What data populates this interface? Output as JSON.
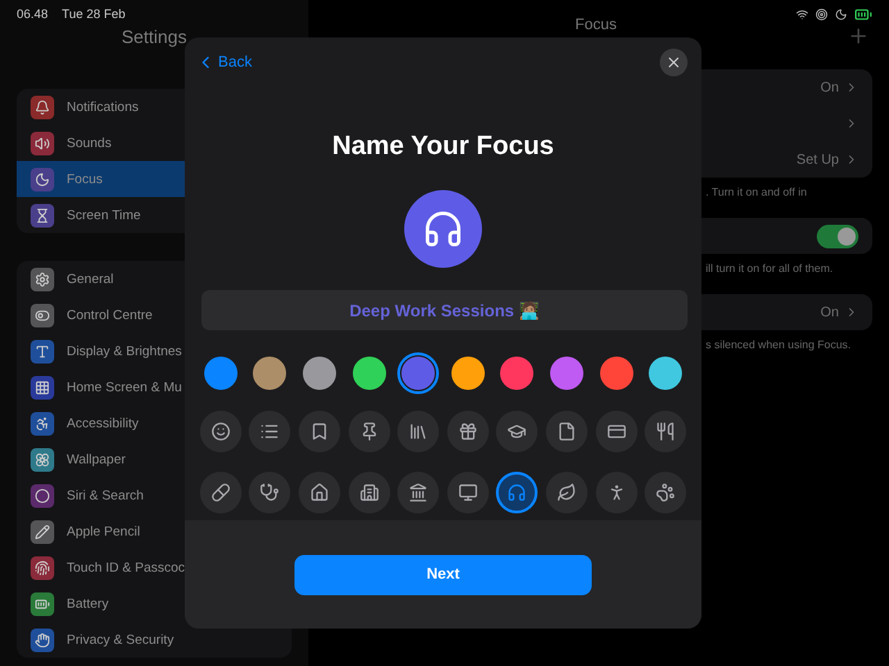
{
  "status_bar": {
    "time": "06.48",
    "date": "Tue 28 Feb"
  },
  "sidebar": {
    "title": "Settings",
    "groups": [
      [
        {
          "label": "Notifications",
          "kind": "bell",
          "color": "#8a2a2a",
          "selected": false
        },
        {
          "label": "Sounds",
          "kind": "speaker",
          "color": "#8a2a3a",
          "selected": false
        },
        {
          "label": "Focus",
          "kind": "moon",
          "color": "#4a3f8a",
          "selected": true
        },
        {
          "label": "Screen Time",
          "kind": "hourglass",
          "color": "#4a3f8a",
          "selected": false
        }
      ],
      [
        {
          "label": "General",
          "kind": "gear",
          "color": "#555558",
          "selected": false
        },
        {
          "label": "Control Centre",
          "kind": "toggles",
          "color": "#555558",
          "selected": false
        },
        {
          "label": "Display & Brightnes",
          "kind": "text",
          "color": "#1f4f9a",
          "selected": false
        },
        {
          "label": "Home Screen & Mu",
          "kind": "grid",
          "color": "#2a3a9a",
          "selected": false
        },
        {
          "label": "Accessibility",
          "kind": "person",
          "color": "#1f4f9a",
          "selected": false
        },
        {
          "label": "Wallpaper",
          "kind": "flower",
          "color": "#2f7a8a",
          "selected": false
        },
        {
          "label": "Siri & Search",
          "kind": "orb",
          "color": "#5a2a6a",
          "selected": false
        },
        {
          "label": "Apple Pencil",
          "kind": "pencil",
          "color": "#555558",
          "selected": false
        },
        {
          "label": "Touch ID & Passcoc",
          "kind": "fingerprint",
          "color": "#8a2a3a",
          "selected": false
        },
        {
          "label": "Battery",
          "kind": "battery",
          "color": "#2a7a3a",
          "selected": false
        },
        {
          "label": "Privacy & Security",
          "kind": "hand",
          "color": "#1f4f9a",
          "selected": false
        }
      ]
    ]
  },
  "detail": {
    "title": "Focus",
    "cards": [
      {
        "rows": [
          {
            "value": "On"
          },
          {
            "value": ""
          },
          {
            "value": "Set Up"
          }
        ],
        "note": ". Turn it on and off in"
      },
      {
        "rows": [
          {
            "toggle": true
          }
        ],
        "note": "ill turn it on for all of them."
      },
      {
        "rows": [
          {
            "value": "On"
          }
        ],
        "note": "s silenced when using Focus."
      }
    ]
  },
  "modal": {
    "back": "Back",
    "title": "Name Your Focus",
    "name_value": "Deep Work Sessions 🧑🏽‍💻",
    "colors": [
      {
        "color": "#0a84ff",
        "selected": false
      },
      {
        "color": "#ac8e68",
        "selected": false
      },
      {
        "color": "#98989d",
        "selected": false
      },
      {
        "color": "#30d158",
        "selected": false
      },
      {
        "color": "#5e5ce6",
        "selected": true
      },
      {
        "color": "#ff9f0a",
        "selected": false
      },
      {
        "color": "#ff375f",
        "selected": false
      },
      {
        "color": "#bf5af2",
        "selected": false
      },
      {
        "color": "#ff453a",
        "selected": false
      },
      {
        "color": "#40c8e0",
        "selected": false
      }
    ],
    "icons": [
      {
        "kind": "smile",
        "selected": false
      },
      {
        "kind": "list",
        "selected": false
      },
      {
        "kind": "bookmark",
        "selected": false
      },
      {
        "kind": "pin",
        "selected": false
      },
      {
        "kind": "books",
        "selected": false
      },
      {
        "kind": "gift",
        "selected": false
      },
      {
        "kind": "cap",
        "selected": false
      },
      {
        "kind": "file",
        "selected": false
      },
      {
        "kind": "card",
        "selected": false
      },
      {
        "kind": "utensils",
        "selected": false
      },
      {
        "kind": "pill",
        "selected": false
      },
      {
        "kind": "stethoscope",
        "selected": false
      },
      {
        "kind": "house",
        "selected": false
      },
      {
        "kind": "building",
        "selected": false
      },
      {
        "kind": "landmark",
        "selected": false
      },
      {
        "kind": "monitor",
        "selected": false
      },
      {
        "kind": "headphones",
        "selected": true
      },
      {
        "kind": "leaf",
        "selected": false
      },
      {
        "kind": "person",
        "selected": false
      },
      {
        "kind": "paw",
        "selected": false
      }
    ],
    "next": "Next"
  }
}
